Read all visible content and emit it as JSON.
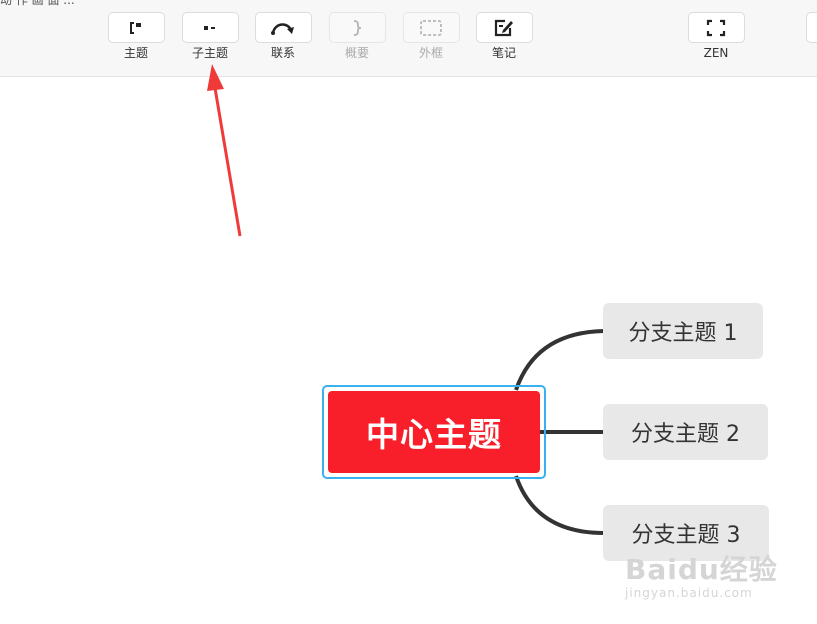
{
  "top_cut_text": "动  作  画  面  ...",
  "toolbar": {
    "items": [
      {
        "label": "主题",
        "icon": "topic-icon",
        "enabled": true
      },
      {
        "label": "子主题",
        "icon": "subtopic-icon",
        "enabled": true
      },
      {
        "label": "联系",
        "icon": "relationship-icon",
        "enabled": true
      },
      {
        "label": "概要",
        "icon": "summary-icon",
        "enabled": false
      },
      {
        "label": "外框",
        "icon": "boundary-icon",
        "enabled": false
      },
      {
        "label": "笔记",
        "icon": "note-icon",
        "enabled": true
      },
      {
        "label": "ZEN",
        "icon": "zen-fullscreen-icon",
        "enabled": true
      }
    ]
  },
  "mindmap": {
    "central": "中心主题",
    "branches": [
      "分支主题 1",
      "分支主题 2",
      "分支主题 3"
    ]
  },
  "watermark": {
    "logo": "Baidu经验",
    "url": "jingyan.baidu.com"
  },
  "colors": {
    "central_fill": "#f81f2b",
    "selection": "#3bb0ef",
    "branch_fill": "#e8e8e8",
    "arrow": "#f03a3a"
  }
}
